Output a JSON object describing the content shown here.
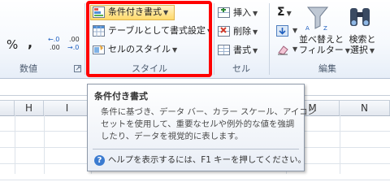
{
  "ribbon": {
    "number_group": {
      "percent": "%",
      "comma": ",",
      "increase_decimal": "←.0\n.00",
      "decrease_decimal": ".00\n→.0",
      "label": "数値"
    },
    "styles_group": {
      "conditional_formatting": "条件付き書式",
      "format_as_table": "テーブルとして書式設定",
      "cell_styles": "セルのスタイル",
      "label": "スタイル"
    },
    "cells_group": {
      "insert": "挿入",
      "delete": "削除",
      "format": "書式",
      "label": "セル"
    },
    "editing_group": {
      "sigma": "Σ",
      "sort_filter_line1": "並べ替えと",
      "sort_filter_line2": "フィルター",
      "find_select_line1": "検索と",
      "find_select_line2": "選択",
      "label": "編集"
    }
  },
  "grid": {
    "columns": [
      "H",
      "I",
      "M",
      "N"
    ]
  },
  "tooltip": {
    "title": "条件付き書式",
    "body_lines": [
      "条件に基づき、データ バー、カラー スケール、アイコン",
      "セットを使用して、重要なセルや例外的な値を強調",
      "したり、データを視覚的に表します。"
    ],
    "help": "ヘルプを表示するには、F1 キーを押してください。"
  },
  "colors": {
    "highlight": "#ff0000",
    "help_icon": "#3b7bd0",
    "accent_hover": "#ffd96a"
  }
}
